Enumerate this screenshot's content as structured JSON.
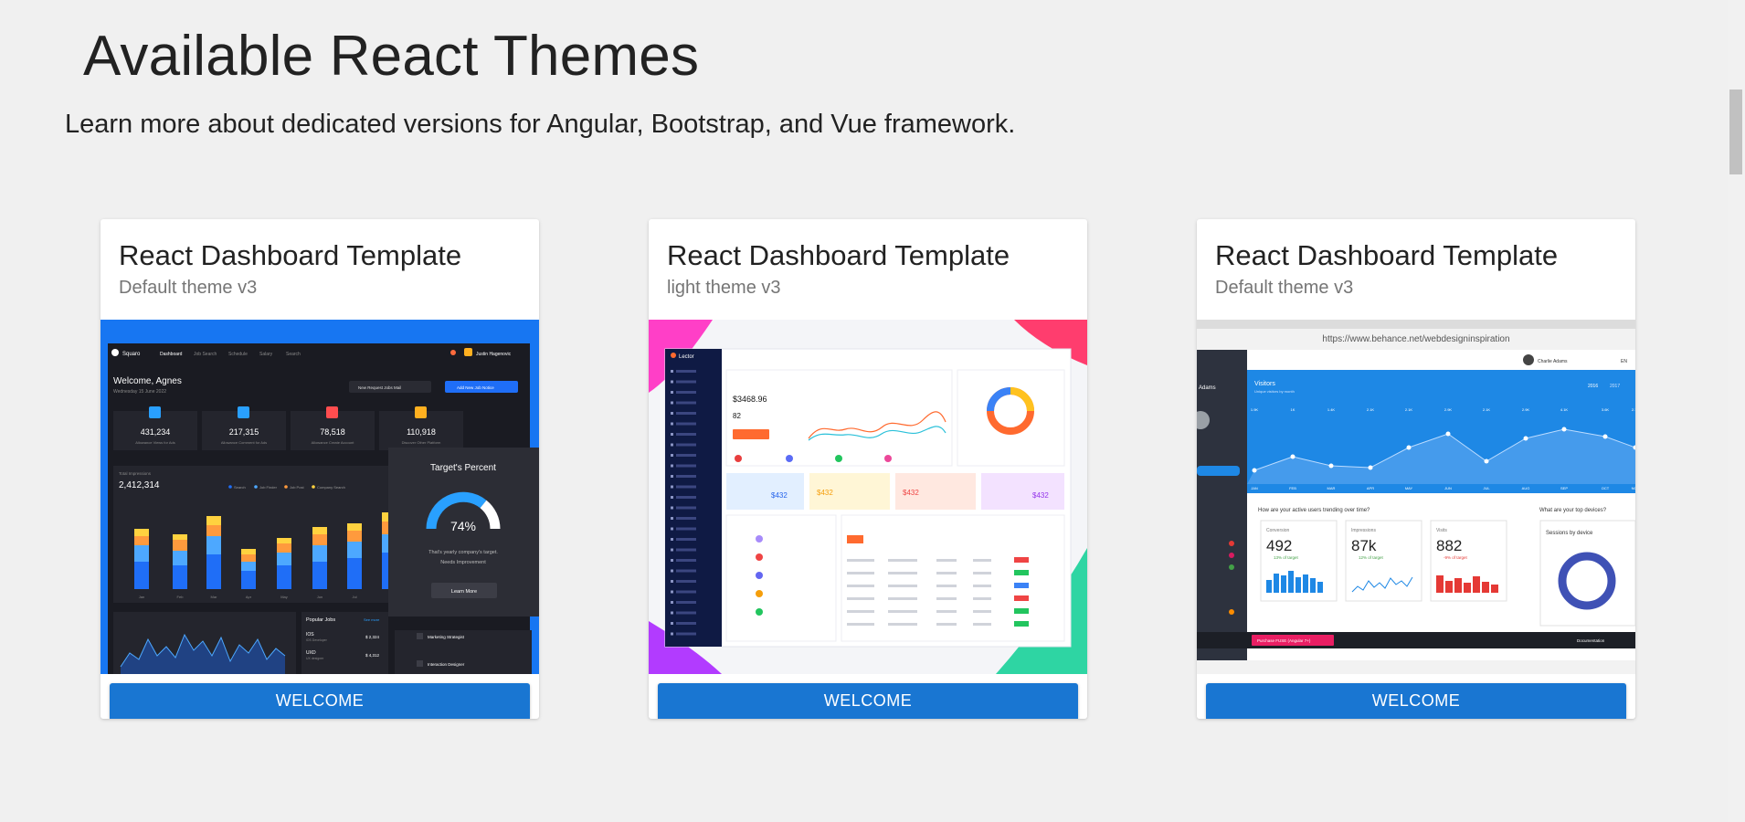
{
  "header": {
    "title": "Available React Themes",
    "subtitle": "Learn more about dedicated versions for Angular, Bootstrap, and Vue framework."
  },
  "cards": [
    {
      "title": "React Dashboard Template",
      "subtitle": "Default theme v3",
      "button": "WELCOME",
      "preview": {
        "brand": "Squaro",
        "nav": [
          "Dashboard",
          "Job Search",
          "Schedule",
          "Salary",
          "Search"
        ],
        "user": "Justin Hagenovic",
        "welcome": "Welcome, Agnes",
        "date": "Wednesday 15 June 2022",
        "buttons": [
          "New Request Jobs Mail",
          "Add New Job Notice"
        ],
        "stats": [
          {
            "value": "431,234",
            "label": "Allowance Views for Ads"
          },
          {
            "value": "217,315",
            "label": "Allowance Comment for Ads"
          },
          {
            "value": "78,518",
            "label": "Allowance Create Account"
          },
          {
            "value": "110,918",
            "label": "Discover Other Platform"
          }
        ],
        "chart_title": "Total Impressions",
        "chart_total": "2,412,314",
        "chart_legend": [
          "Search",
          "Job Finder",
          "Job Post",
          "Company Search"
        ],
        "months": [
          "Jan",
          "Feb",
          "Mar",
          "Apr",
          "May",
          "Jun",
          "Jul"
        ],
        "popover_title": "Target's Percent",
        "popover_value": "74%",
        "popover_text_1": "That's yearly company's target.",
        "popover_text_2": "Needs Improvement",
        "popover_button": "Learn More",
        "popular_title": "Popular Jobs",
        "popular_link": "See more",
        "popular_items": [
          {
            "name": "IOS",
            "sub": "iOS Developer",
            "value": "$ 2,324"
          },
          {
            "name": "UXD",
            "sub": "UX designer",
            "value": "$ 4,312"
          }
        ],
        "side_items": [
          "Marketing Strategist",
          "Interaction Designer"
        ]
      }
    },
    {
      "title": "React Dashboard Template",
      "subtitle": "light theme v3",
      "button": "WELCOME",
      "preview": {
        "brand": "Lector",
        "money": "$3468.96",
        "count": "82",
        "tag": "$432"
      }
    },
    {
      "title": "React Dashboard Template",
      "subtitle": "Default theme v3",
      "button": "WELCOME",
      "preview": {
        "url": "https://www.behance.net/webdesigninspiration",
        "user": "Charlie Adams",
        "lang": "EN",
        "side_name": "Adams",
        "visitors_title": "Visitors",
        "visitors_sub": "Unique visitors by month",
        "years": [
          "2016",
          "2017"
        ],
        "values": [
          "1.9K",
          "1K",
          "1.4K",
          "2.1K",
          "2.1K",
          "2.9K",
          "2.1K",
          "2.9K",
          "4.1K",
          "3.6K",
          "2.1K"
        ],
        "months": [
          "JAN",
          "FEB",
          "MAR",
          "APR",
          "MAY",
          "JUN",
          "JUL",
          "AUG",
          "SEP",
          "OCT",
          "NOV"
        ],
        "trend_question": "How are your active users trending over time?",
        "devices_question": "What are your top devices?",
        "metrics": [
          {
            "label": "Conversion",
            "value": "492",
            "delta": "13% of target"
          },
          {
            "label": "Impressions",
            "value": "87k",
            "delta": "12% of target"
          },
          {
            "label": "Visits",
            "value": "882",
            "delta": "-9% of target"
          }
        ],
        "sessions": "Sessions by device",
        "purchase": "Purchase FUSE (Angular 7+)",
        "docs": "Documentation"
      }
    }
  ],
  "colors": {
    "accent": "#1976d2",
    "page_bg": "#f0f0f0"
  }
}
